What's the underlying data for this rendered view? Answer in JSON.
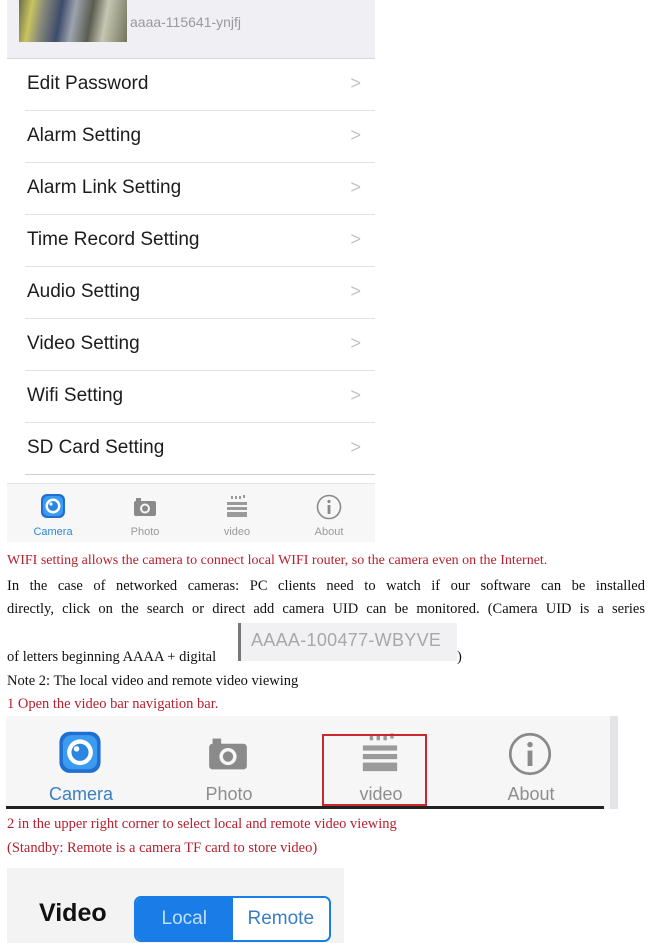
{
  "device": {
    "id": "aaaa-115641-ynjfj"
  },
  "settings_menu": {
    "items": [
      {
        "label": "Edit Password"
      },
      {
        "label": "Alarm Setting"
      },
      {
        "label": "Alarm Link Setting"
      },
      {
        "label": "Time Record Setting"
      },
      {
        "label": "Audio Setting"
      },
      {
        "label": "Video Setting"
      },
      {
        "label": "Wifi Setting"
      },
      {
        "label": "SD Card Setting"
      }
    ],
    "chevron": ">"
  },
  "tab_bar": {
    "active": "Camera",
    "tabs": [
      {
        "label": "Camera",
        "icon": "camera-app-icon"
      },
      {
        "label": "Photo",
        "icon": "photo-camera-icon"
      },
      {
        "label": "video",
        "icon": "clapperboard-icon"
      },
      {
        "label": "About",
        "icon": "info-icon"
      }
    ]
  },
  "document": {
    "para1": "WIFI setting allows the camera to connect local WIFI router, so the camera even on the Internet.",
    "para2_line1": "In the case of networked cameras: PC clients need to watch if our software can be installed",
    "para2_line2": "directly, click on the search or direct add camera UID can be monitored. (Camera UID is a series",
    "para2_line3": "of letters beginning AAAA + digital",
    "para2_close": ")",
    "uid_example": "AAAA-100477-WBYVE",
    "note2": "Note 2: The local video and remote video viewing",
    "step1": "1 Open the video bar navigation bar.",
    "step2": "2 in the upper right corner to select local and remote video viewing",
    "standby": "(Standby: Remote is a camera TF card to store video)"
  },
  "highlighted_tab": "video",
  "video_header": {
    "title": "Video",
    "segments": [
      {
        "label": "Local",
        "selected": true
      },
      {
        "label": "Remote",
        "selected": false
      }
    ]
  },
  "colors": {
    "accent_blue": "#1a7ce6",
    "annotation_red": "#b42030",
    "highlight_box": "#c8282e"
  }
}
